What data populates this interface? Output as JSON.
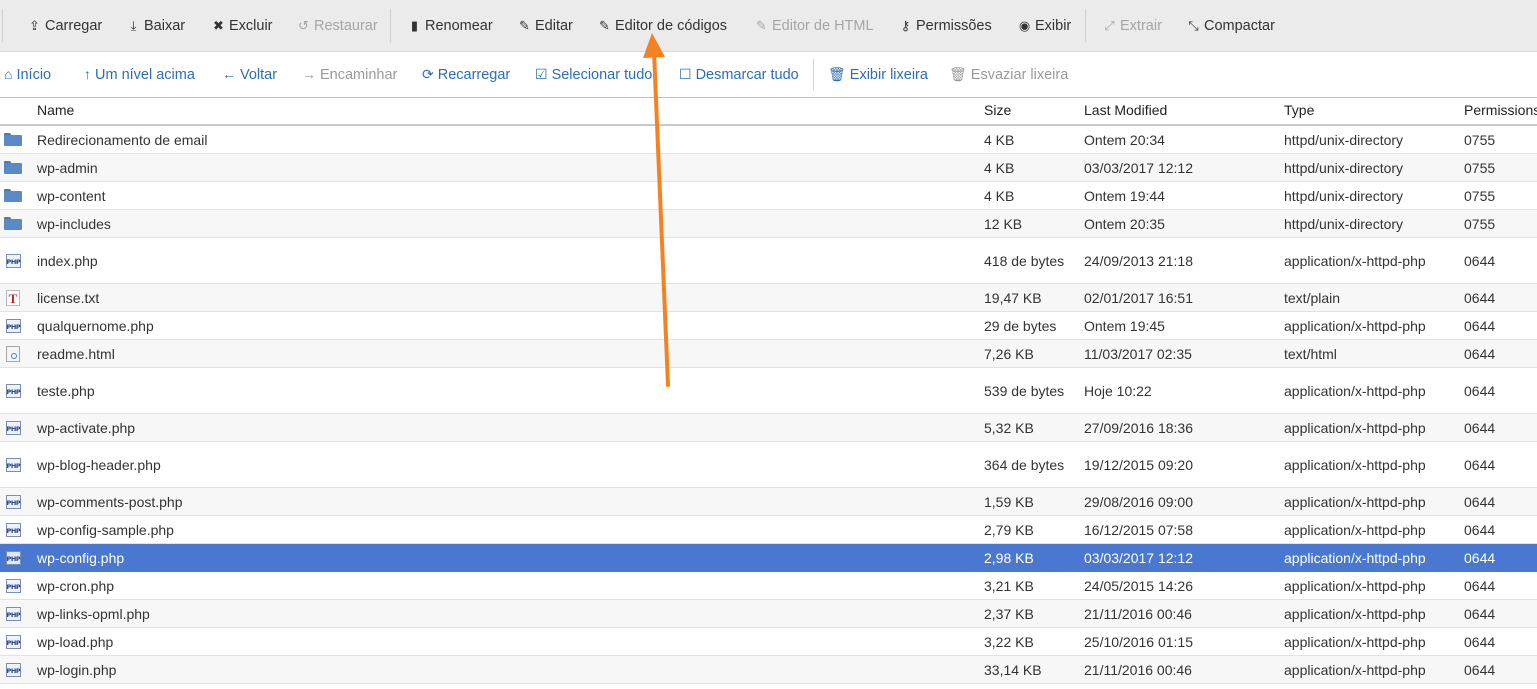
{
  "toolbar": {
    "buttons": [
      {
        "icon": "upload-icon",
        "glyph": "⇪",
        "label": "Carregar",
        "disabled": false
      },
      {
        "icon": "download-icon",
        "glyph": "⤓",
        "label": "Baixar",
        "disabled": false
      },
      {
        "icon": "delete-icon",
        "glyph": "✖",
        "label": "Excluir",
        "disabled": false
      },
      {
        "icon": "restore-icon",
        "glyph": "↺",
        "label": "Restaurar",
        "disabled": true
      },
      {
        "icon": "file-icon",
        "glyph": "▮",
        "label": "Renomear",
        "disabled": false
      },
      {
        "icon": "pencil-icon",
        "glyph": "✎",
        "label": "Editar",
        "disabled": false
      },
      {
        "icon": "code-edit-icon",
        "glyph": "✎",
        "label": "Editor de códigos",
        "disabled": false
      },
      {
        "icon": "html-edit-icon",
        "glyph": "✎",
        "label": "Editor de HTML",
        "disabled": true
      },
      {
        "icon": "key-icon",
        "glyph": "⚷",
        "label": "Permissões",
        "disabled": false
      },
      {
        "icon": "eye-icon",
        "glyph": "◉",
        "label": "Exibir",
        "disabled": false
      },
      {
        "icon": "extract-icon",
        "glyph": "⤢",
        "label": "Extrair",
        "disabled": true
      },
      {
        "icon": "compress-icon",
        "glyph": "⤡",
        "label": "Compactar",
        "disabled": false
      }
    ]
  },
  "navbar": {
    "buttons": [
      {
        "icon": "home-icon",
        "glyph": "⌂",
        "label": "Início",
        "disabled": false
      },
      {
        "icon": "level-up-icon",
        "glyph": "↑",
        "label": "Um nível acima",
        "disabled": false
      },
      {
        "icon": "back-arrow-icon",
        "glyph": "←",
        "label": "Voltar",
        "disabled": false
      },
      {
        "icon": "forward-arrow-icon",
        "glyph": "→",
        "label": "Encaminhar",
        "disabled": true
      },
      {
        "icon": "refresh-icon",
        "glyph": "⟳",
        "label": "Recarregar",
        "disabled": false
      },
      {
        "icon": "check-square-icon",
        "glyph": "☑",
        "label": "Selecionar tudo",
        "disabled": false
      },
      {
        "icon": "square-icon",
        "glyph": "☐",
        "label": "Desmarcar tudo",
        "disabled": false
      },
      {
        "icon": "trash-icon",
        "glyph": "🗑",
        "label": "Exibir lixeira",
        "disabled": false
      },
      {
        "icon": "trash-empty-icon",
        "glyph": "🗑",
        "label": "Esvaziar lixeira",
        "disabled": true
      }
    ]
  },
  "table": {
    "columns": {
      "name": "Name",
      "size": "Size",
      "modified": "Last Modified",
      "type": "Type",
      "permissions": "Permissions"
    },
    "rows": [
      {
        "icon": "folder",
        "name": "Redirecionamento de email",
        "size": "4 KB",
        "modified": "Ontem 20:34",
        "type": "httpd/unix-directory",
        "perm": "0755"
      },
      {
        "icon": "folder",
        "name": "wp-admin",
        "size": "4 KB",
        "modified": "03/03/2017 12:12",
        "type": "httpd/unix-directory",
        "perm": "0755"
      },
      {
        "icon": "folder",
        "name": "wp-content",
        "size": "4 KB",
        "modified": "Ontem 19:44",
        "type": "httpd/unix-directory",
        "perm": "0755"
      },
      {
        "icon": "folder",
        "name": "wp-includes",
        "size": "12 KB",
        "modified": "Ontem 20:35",
        "type": "httpd/unix-directory",
        "perm": "0755"
      },
      {
        "icon": "php",
        "name": "index.php",
        "size": "418 de bytes",
        "modified": "24/09/2013 21:18",
        "type": "application/x-httpd-php",
        "perm": "0644"
      },
      {
        "icon": "txt",
        "name": "license.txt",
        "size": "19,47 KB",
        "modified": "02/01/2017 16:51",
        "type": "text/plain",
        "perm": "0644"
      },
      {
        "icon": "php",
        "name": "qualquernome.php",
        "size": "29 de bytes",
        "modified": "Ontem 19:45",
        "type": "application/x-httpd-php",
        "perm": "0644"
      },
      {
        "icon": "html",
        "name": "readme.html",
        "size": "7,26 KB",
        "modified": "11/03/2017 02:35",
        "type": "text/html",
        "perm": "0644"
      },
      {
        "icon": "php",
        "name": "teste.php",
        "size": "539 de bytes",
        "modified": "Hoje 10:22",
        "type": "application/x-httpd-php",
        "perm": "0644"
      },
      {
        "icon": "php",
        "name": "wp-activate.php",
        "size": "5,32 KB",
        "modified": "27/09/2016 18:36",
        "type": "application/x-httpd-php",
        "perm": "0644"
      },
      {
        "icon": "php",
        "name": "wp-blog-header.php",
        "size": "364 de bytes",
        "modified": "19/12/2015 09:20",
        "type": "application/x-httpd-php",
        "perm": "0644"
      },
      {
        "icon": "php",
        "name": "wp-comments-post.php",
        "size": "1,59 KB",
        "modified": "29/08/2016 09:00",
        "type": "application/x-httpd-php",
        "perm": "0644"
      },
      {
        "icon": "php",
        "name": "wp-config-sample.php",
        "size": "2,79 KB",
        "modified": "16/12/2015 07:58",
        "type": "application/x-httpd-php",
        "perm": "0644"
      },
      {
        "icon": "php",
        "name": "wp-config.php",
        "size": "2,98 KB",
        "modified": "03/03/2017 12:12",
        "type": "application/x-httpd-php",
        "perm": "0644",
        "selected": true
      },
      {
        "icon": "php",
        "name": "wp-cron.php",
        "size": "3,21 KB",
        "modified": "24/05/2015 14:26",
        "type": "application/x-httpd-php",
        "perm": "0644"
      },
      {
        "icon": "php",
        "name": "wp-links-opml.php",
        "size": "2,37 KB",
        "modified": "21/11/2016 00:46",
        "type": "application/x-httpd-php",
        "perm": "0644"
      },
      {
        "icon": "php",
        "name": "wp-load.php",
        "size": "3,22 KB",
        "modified": "25/10/2016 01:15",
        "type": "application/x-httpd-php",
        "perm": "0644"
      },
      {
        "icon": "php",
        "name": "wp-login.php",
        "size": "33,14 KB",
        "modified": "21/11/2016 00:46",
        "type": "application/x-httpd-php",
        "perm": "0644"
      }
    ]
  },
  "annotation": {
    "color": "#f58220"
  },
  "colors": {
    "selected_row": "#4a77d0",
    "link": "#2a6fb8"
  }
}
